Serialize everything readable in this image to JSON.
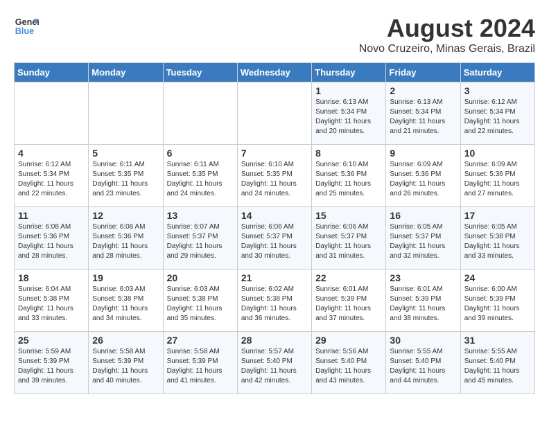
{
  "logo": {
    "line1": "General",
    "line2": "Blue"
  },
  "title": "August 2024",
  "location": "Novo Cruzeiro, Minas Gerais, Brazil",
  "weekdays": [
    "Sunday",
    "Monday",
    "Tuesday",
    "Wednesday",
    "Thursday",
    "Friday",
    "Saturday"
  ],
  "weeks": [
    [
      {
        "day": "",
        "info": ""
      },
      {
        "day": "",
        "info": ""
      },
      {
        "day": "",
        "info": ""
      },
      {
        "day": "",
        "info": ""
      },
      {
        "day": "1",
        "info": "Sunrise: 6:13 AM\nSunset: 5:34 PM\nDaylight: 11 hours\nand 20 minutes."
      },
      {
        "day": "2",
        "info": "Sunrise: 6:13 AM\nSunset: 5:34 PM\nDaylight: 11 hours\nand 21 minutes."
      },
      {
        "day": "3",
        "info": "Sunrise: 6:12 AM\nSunset: 5:34 PM\nDaylight: 11 hours\nand 22 minutes."
      }
    ],
    [
      {
        "day": "4",
        "info": "Sunrise: 6:12 AM\nSunset: 5:34 PM\nDaylight: 11 hours\nand 22 minutes."
      },
      {
        "day": "5",
        "info": "Sunrise: 6:11 AM\nSunset: 5:35 PM\nDaylight: 11 hours\nand 23 minutes."
      },
      {
        "day": "6",
        "info": "Sunrise: 6:11 AM\nSunset: 5:35 PM\nDaylight: 11 hours\nand 24 minutes."
      },
      {
        "day": "7",
        "info": "Sunrise: 6:10 AM\nSunset: 5:35 PM\nDaylight: 11 hours\nand 24 minutes."
      },
      {
        "day": "8",
        "info": "Sunrise: 6:10 AM\nSunset: 5:36 PM\nDaylight: 11 hours\nand 25 minutes."
      },
      {
        "day": "9",
        "info": "Sunrise: 6:09 AM\nSunset: 5:36 PM\nDaylight: 11 hours\nand 26 minutes."
      },
      {
        "day": "10",
        "info": "Sunrise: 6:09 AM\nSunset: 5:36 PM\nDaylight: 11 hours\nand 27 minutes."
      }
    ],
    [
      {
        "day": "11",
        "info": "Sunrise: 6:08 AM\nSunset: 5:36 PM\nDaylight: 11 hours\nand 28 minutes."
      },
      {
        "day": "12",
        "info": "Sunrise: 6:08 AM\nSunset: 5:36 PM\nDaylight: 11 hours\nand 28 minutes."
      },
      {
        "day": "13",
        "info": "Sunrise: 6:07 AM\nSunset: 5:37 PM\nDaylight: 11 hours\nand 29 minutes."
      },
      {
        "day": "14",
        "info": "Sunrise: 6:06 AM\nSunset: 5:37 PM\nDaylight: 11 hours\nand 30 minutes."
      },
      {
        "day": "15",
        "info": "Sunrise: 6:06 AM\nSunset: 5:37 PM\nDaylight: 11 hours\nand 31 minutes."
      },
      {
        "day": "16",
        "info": "Sunrise: 6:05 AM\nSunset: 5:37 PM\nDaylight: 11 hours\nand 32 minutes."
      },
      {
        "day": "17",
        "info": "Sunrise: 6:05 AM\nSunset: 5:38 PM\nDaylight: 11 hours\nand 33 minutes."
      }
    ],
    [
      {
        "day": "18",
        "info": "Sunrise: 6:04 AM\nSunset: 5:38 PM\nDaylight: 11 hours\nand 33 minutes."
      },
      {
        "day": "19",
        "info": "Sunrise: 6:03 AM\nSunset: 5:38 PM\nDaylight: 11 hours\nand 34 minutes."
      },
      {
        "day": "20",
        "info": "Sunrise: 6:03 AM\nSunset: 5:38 PM\nDaylight: 11 hours\nand 35 minutes."
      },
      {
        "day": "21",
        "info": "Sunrise: 6:02 AM\nSunset: 5:38 PM\nDaylight: 11 hours\nand 36 minutes."
      },
      {
        "day": "22",
        "info": "Sunrise: 6:01 AM\nSunset: 5:39 PM\nDaylight: 11 hours\nand 37 minutes."
      },
      {
        "day": "23",
        "info": "Sunrise: 6:01 AM\nSunset: 5:39 PM\nDaylight: 11 hours\nand 38 minutes."
      },
      {
        "day": "24",
        "info": "Sunrise: 6:00 AM\nSunset: 5:39 PM\nDaylight: 11 hours\nand 39 minutes."
      }
    ],
    [
      {
        "day": "25",
        "info": "Sunrise: 5:59 AM\nSunset: 5:39 PM\nDaylight: 11 hours\nand 39 minutes."
      },
      {
        "day": "26",
        "info": "Sunrise: 5:58 AM\nSunset: 5:39 PM\nDaylight: 11 hours\nand 40 minutes."
      },
      {
        "day": "27",
        "info": "Sunrise: 5:58 AM\nSunset: 5:39 PM\nDaylight: 11 hours\nand 41 minutes."
      },
      {
        "day": "28",
        "info": "Sunrise: 5:57 AM\nSunset: 5:40 PM\nDaylight: 11 hours\nand 42 minutes."
      },
      {
        "day": "29",
        "info": "Sunrise: 5:56 AM\nSunset: 5:40 PM\nDaylight: 11 hours\nand 43 minutes."
      },
      {
        "day": "30",
        "info": "Sunrise: 5:55 AM\nSunset: 5:40 PM\nDaylight: 11 hours\nand 44 minutes."
      },
      {
        "day": "31",
        "info": "Sunrise: 5:55 AM\nSunset: 5:40 PM\nDaylight: 11 hours\nand 45 minutes."
      }
    ]
  ]
}
